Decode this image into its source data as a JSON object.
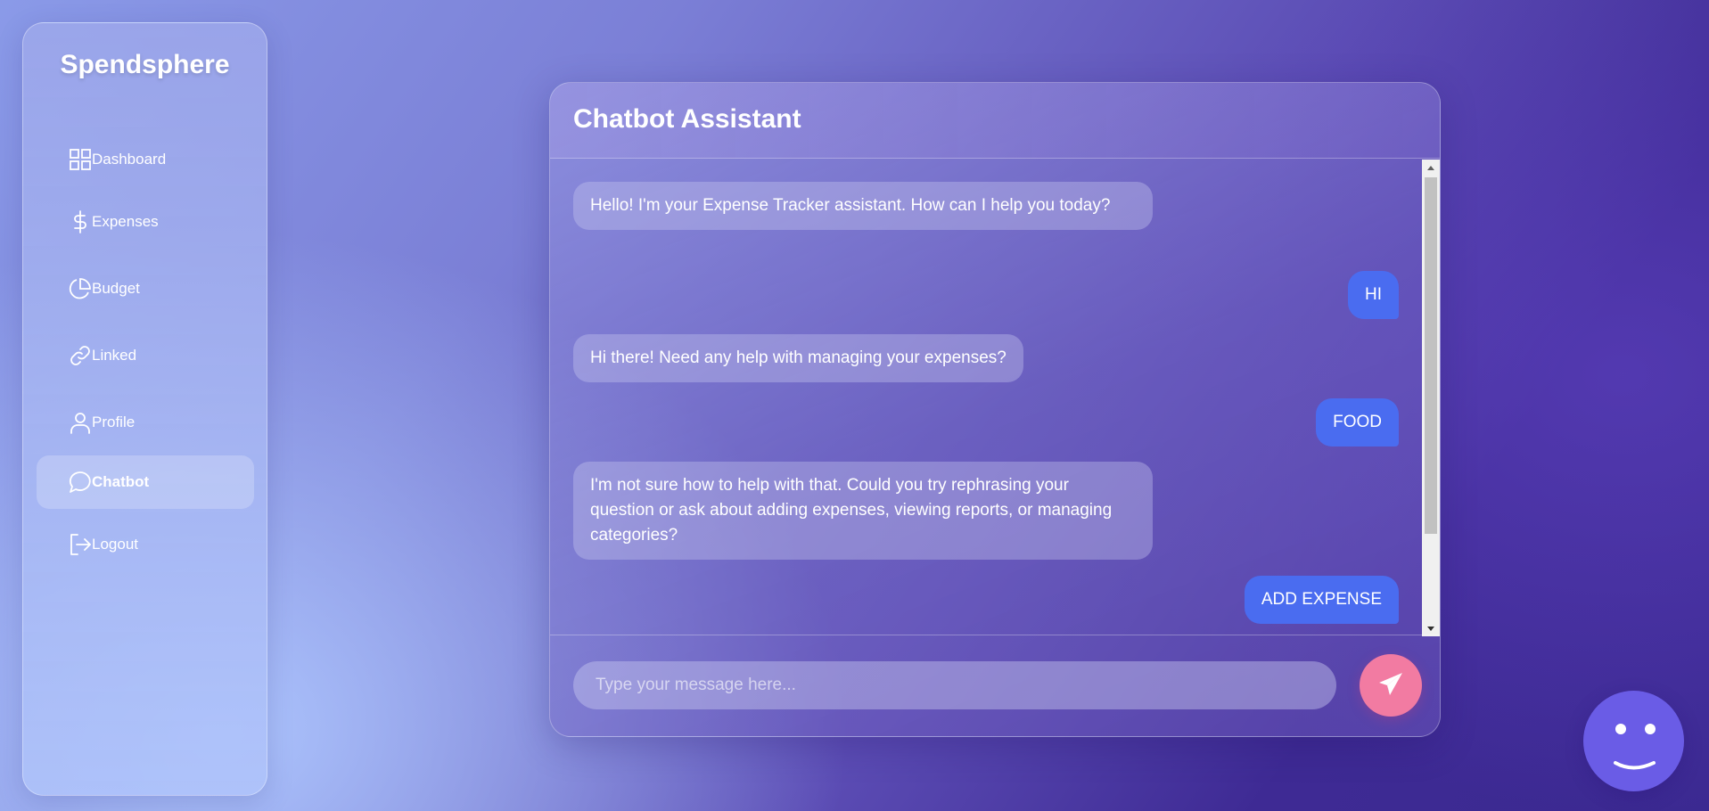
{
  "app": {
    "brand": "Spendsphere"
  },
  "sidebar": {
    "items": [
      {
        "label": "Dashboard",
        "icon": "grid-icon",
        "active": false
      },
      {
        "label": "Expenses",
        "icon": "dollar-icon",
        "active": false
      },
      {
        "label": "Budget",
        "icon": "pie-chart-icon",
        "active": false
      },
      {
        "label": "Linked",
        "icon": "link-icon",
        "active": false
      },
      {
        "label": "Profile",
        "icon": "user-icon",
        "active": false
      },
      {
        "label": "Chatbot",
        "icon": "chat-bubble-icon",
        "active": true
      },
      {
        "label": "Logout",
        "icon": "logout-icon",
        "active": false
      }
    ]
  },
  "chat": {
    "title": "Chatbot Assistant",
    "messages": [
      {
        "sender": "bot",
        "text": "Hello! I'm your Expense Tracker assistant. How can I help you today?"
      },
      {
        "sender": "user",
        "text": "HI"
      },
      {
        "sender": "bot",
        "text": "Hi there! Need any help with managing your expenses?"
      },
      {
        "sender": "user",
        "text": "FOOD"
      },
      {
        "sender": "bot",
        "text": "I'm not sure how to help with that. Could you try rephrasing your question or ask about adding expenses, viewing reports, or managing categories?"
      },
      {
        "sender": "user",
        "text": "ADD EXPENSE"
      }
    ],
    "input": {
      "value": "",
      "placeholder": "Type your message here..."
    },
    "send_icon": "send-icon"
  },
  "floating_avatar": {
    "icon": "smiley-icon"
  },
  "colors": {
    "user_bubble": "#4a6cf0",
    "send_button": "#f27ba2",
    "avatar": "#6a5ce6"
  }
}
